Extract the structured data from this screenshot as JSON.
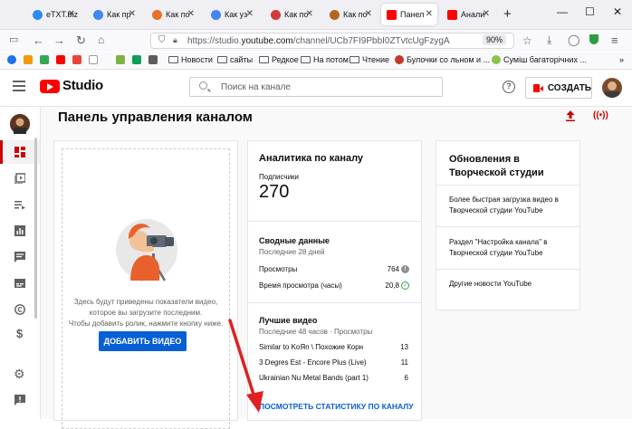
{
  "browser": {
    "tabs": [
      {
        "label": "eTXT.biz",
        "color": "#2d8cf0"
      },
      {
        "label": "Как пр",
        "color": "#4285f4"
      },
      {
        "label": "Как по",
        "color": "#e8712b"
      },
      {
        "label": "Как уз",
        "color": "#4285f4"
      },
      {
        "label": "Как по",
        "color": "#d33c3c"
      },
      {
        "label": "Как по",
        "color": "#b5651d"
      },
      {
        "label": "Панел",
        "color": "#ff0000"
      },
      {
        "label": "Анали",
        "color": "#ff0000"
      }
    ],
    "new_tab": "+",
    "url_prefix": "https://studio.",
    "url_domain": "youtube.com",
    "url_path": "/channel/UCb7FI9PbbI0ZTvtcUgFzygA",
    "zoom": "90%",
    "bookmarks": [
      "Новости",
      "сайты",
      "Редкое",
      "На потом",
      "Чтение",
      "Булочки со льном и ...",
      "Сумiш багатoрiчних ..."
    ],
    "overflow": "»"
  },
  "studio": {
    "brand": "Studio",
    "search_placeholder": "Поиск на канале",
    "help": "?",
    "create_label": "СОЗДАТЬ",
    "page_title": "Панель управления каналом",
    "left_card": {
      "description_lines": [
        "Здесь будут приведены показатели видео,",
        "которое вы загрузите последним.",
        "Чтобы добавить ролик, нажмите кнопку ниже."
      ],
      "add_button": "ДОБАВИТЬ ВИДЕО"
    },
    "analytics": {
      "title": "Аналитика по каналу",
      "subs_label": "Подписчики",
      "subs_value": "270",
      "summary_title": "Сводные данные",
      "summary_sub": "Последние 28 дней",
      "rows": [
        {
          "label": "Просмотры",
          "value": "764"
        },
        {
          "label": "Время просмотра (часы)",
          "value": "20,8"
        }
      ],
      "top_title": "Лучшие видео",
      "top_sub": "Последние 48 часов · Просмотры",
      "videos": [
        {
          "label": "Similar to KoЯn \\ Похожие Корн",
          "value": "13"
        },
        {
          "label": "3 Degres Est - Encore Plus (Live)",
          "value": "11"
        },
        {
          "label": "Ukrainian Nu Metal Bands (part 1)",
          "value": "6"
        }
      ],
      "stats_link": "ПОСМОТРЕТЬ СТАТИСТИКУ ПО КАНАЛУ"
    },
    "updates": {
      "title": "Обновления в Творческой студии",
      "items": [
        "Более быстрая загрузка видео в Творческой студии YouTube",
        "Раздел \"Настройка канала\" в Творческой студии YouTube",
        "Другие новости YouTube"
      ]
    }
  }
}
